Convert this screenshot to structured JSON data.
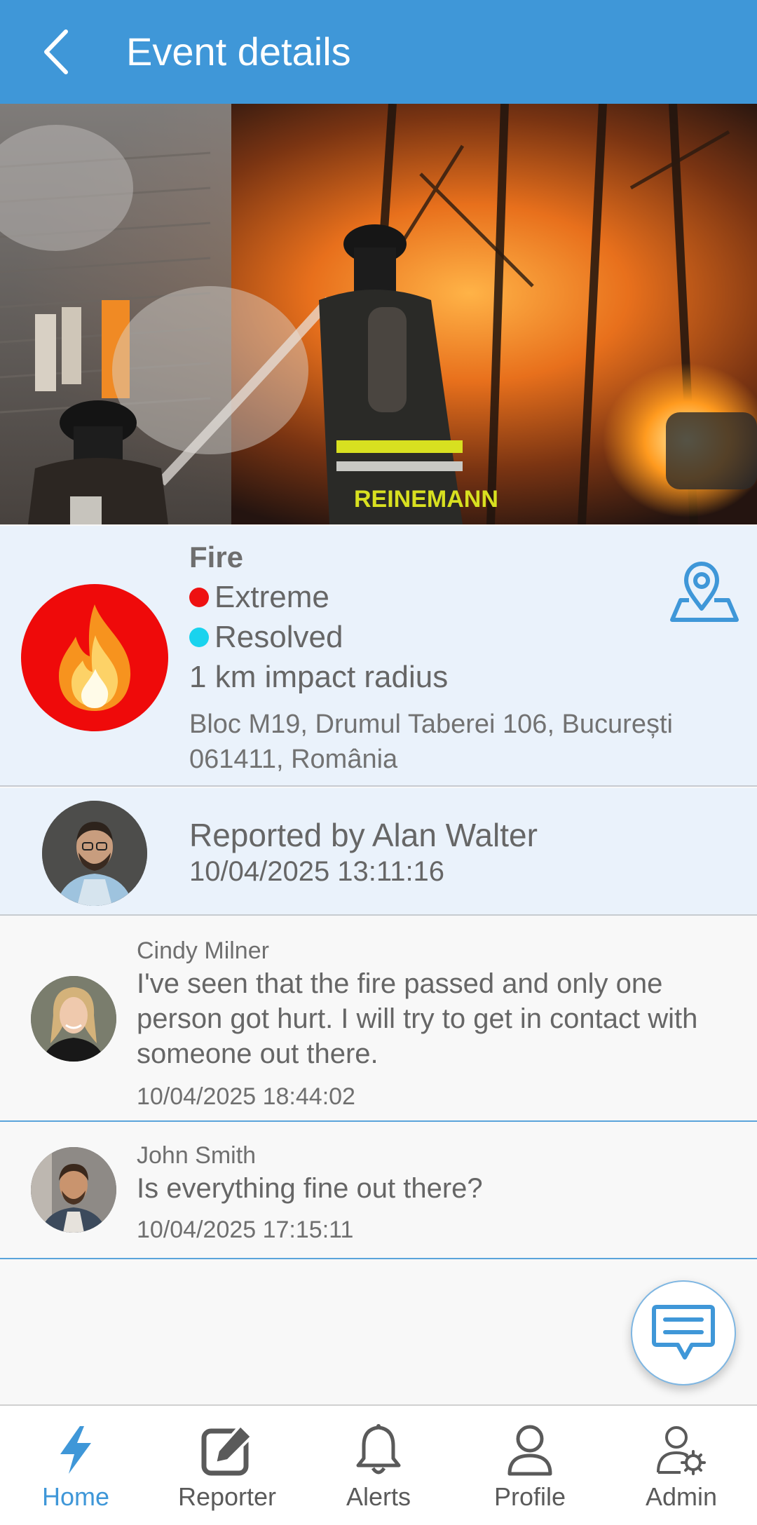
{
  "appbar": {
    "title": "Event details",
    "back_icon": "chevron-left-icon",
    "background": "#3f97d8"
  },
  "hero": {
    "image": "firefighters-fire-scene-photo",
    "helmet_text": "REINEMANN"
  },
  "event": {
    "type": "Fire",
    "icon": "fire-icon",
    "icon_background": "#ef0a0a",
    "severity": {
      "label": "Extreme",
      "color": "#ee1111"
    },
    "status": {
      "label": "Resolved",
      "color": "#19d3ee"
    },
    "radius": "1 km impact radius",
    "address": "Bloc M19, Drumul Taberei 106, București 061411, România",
    "map_icon": "map-pin-icon"
  },
  "reporter": {
    "text": "Reported by Alan Walter",
    "timestamp": "10/04/2025 13:11:16"
  },
  "comments": [
    {
      "author": "Cindy Milner",
      "text": "I've seen that the fire passed and only one person got hurt. I will try to get in contact with someone out there.",
      "timestamp": "10/04/2025 18:44:02"
    },
    {
      "author": "John Smith",
      "text": "Is everything fine out there?",
      "timestamp": "10/04/2025 17:15:11"
    }
  ],
  "fab": {
    "icon": "chat-bubble-icon"
  },
  "bottom_nav": {
    "items": [
      {
        "label": "Home",
        "icon": "lightning-icon",
        "active": true
      },
      {
        "label": "Reporter",
        "icon": "edit-icon",
        "active": false
      },
      {
        "label": "Alerts",
        "icon": "bell-icon",
        "active": false
      },
      {
        "label": "Profile",
        "icon": "user-icon",
        "active": false
      },
      {
        "label": "Admin",
        "icon": "admin-settings-icon",
        "active": false
      }
    ],
    "active_color": "#3f97d8"
  }
}
